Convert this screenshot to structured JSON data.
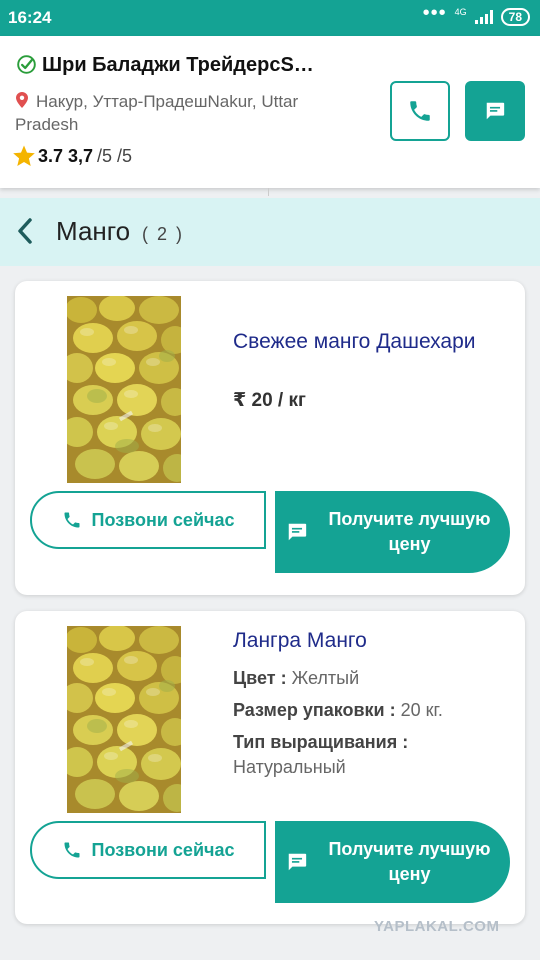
{
  "status_bar": {
    "time": "16:24",
    "dots": "•••",
    "network": "4G",
    "battery": "78"
  },
  "seller": {
    "name": "Шри Баладжи ТрейдерсS…",
    "address": "Накур, Уттар-ПрадешNakur, Uttar Pradesh",
    "rating_bold": "3.7 3,7",
    "rating_rest": "/5 /5"
  },
  "category": {
    "title": "Манго",
    "count": "( 2 )"
  },
  "products": [
    {
      "name": "Свежее манго Дашехари",
      "price": "₹ 20 / кг",
      "call_label": "Позвони сейчас",
      "enquire_label": "Получите лучшую цену"
    },
    {
      "name": "Лангра Манго",
      "specs": [
        {
          "label": "Цвет :",
          "value": "Желтый"
        },
        {
          "label": "Размер упаковки :",
          "value": "20 кг."
        },
        {
          "label": "Тип выращивания :",
          "value": "Натуральный"
        }
      ],
      "call_label": "Позвони сейчас",
      "enquire_label": "Получите лучшую цену"
    }
  ],
  "watermark": "YAPLAKAL.COM",
  "colors": {
    "accent": "#14a394",
    "product_title": "#1f2b8a",
    "category_bg": "#d8f3f3"
  },
  "icons": [
    "check-circle-icon",
    "map-pin-icon",
    "star-icon",
    "phone-icon",
    "chat-icon",
    "back-chevron-icon"
  ]
}
